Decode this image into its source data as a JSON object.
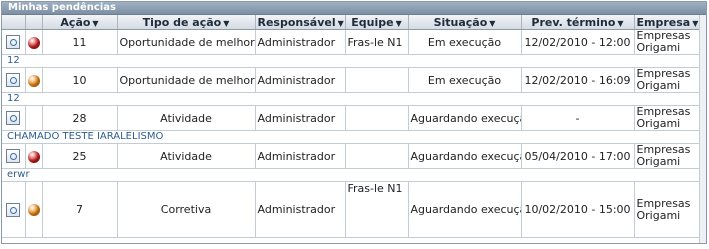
{
  "panel": {
    "title": "Minhas pendências"
  },
  "columns": [
    {
      "label": "Ação"
    },
    {
      "label": "Tipo de ação"
    },
    {
      "label": "Responsável"
    },
    {
      "label": "Equipe"
    },
    {
      "label": "Situação"
    },
    {
      "label": "Prev. término"
    },
    {
      "label": "Empresa"
    }
  ],
  "rows": [
    {
      "status_color": "#d21f1f",
      "acao": "11",
      "tipo": "Oportunidade de melhoria",
      "responsavel": "Administrador",
      "equipe": "Fras-le N1",
      "situacao": "Em execução",
      "prev_termino": "12/02/2010 - 12:00",
      "empresa": "Empresas Origami",
      "descricao": "12"
    },
    {
      "status_color": "#f08a14",
      "acao": "10",
      "tipo": "Oportunidade de melhoria",
      "responsavel": "Administrador",
      "equipe": "",
      "situacao": "Em execução",
      "prev_termino": "12/02/2010 - 16:09",
      "empresa": "Empresas Origami",
      "descricao": "12"
    },
    {
      "status_color": "",
      "acao": "28",
      "tipo": "Atividade",
      "responsavel": "Administrador",
      "equipe": "",
      "situacao": "Aguardando execução",
      "prev_termino": "-",
      "empresa": "Empresas Origami",
      "descricao": "CHAMADO TESTE IARALELISMO"
    },
    {
      "status_color": "#d21f1f",
      "acao": "25",
      "tipo": "Atividade",
      "responsavel": "Administrador",
      "equipe": "",
      "situacao": "Aguardando execução",
      "prev_termino": "05/04/2010 - 17:00",
      "empresa": "Empresas Origami",
      "descricao": "erwr"
    },
    {
      "status_color": "#f08a14",
      "acao": "7",
      "tipo": "Corretiva",
      "responsavel": "Administrador",
      "equipe": "Fras-le N1",
      "situacao": "Aguardando execução",
      "prev_termino": "10/02/2010 - 15:00",
      "empresa": "Empresas Origami",
      "descricao": ""
    }
  ]
}
